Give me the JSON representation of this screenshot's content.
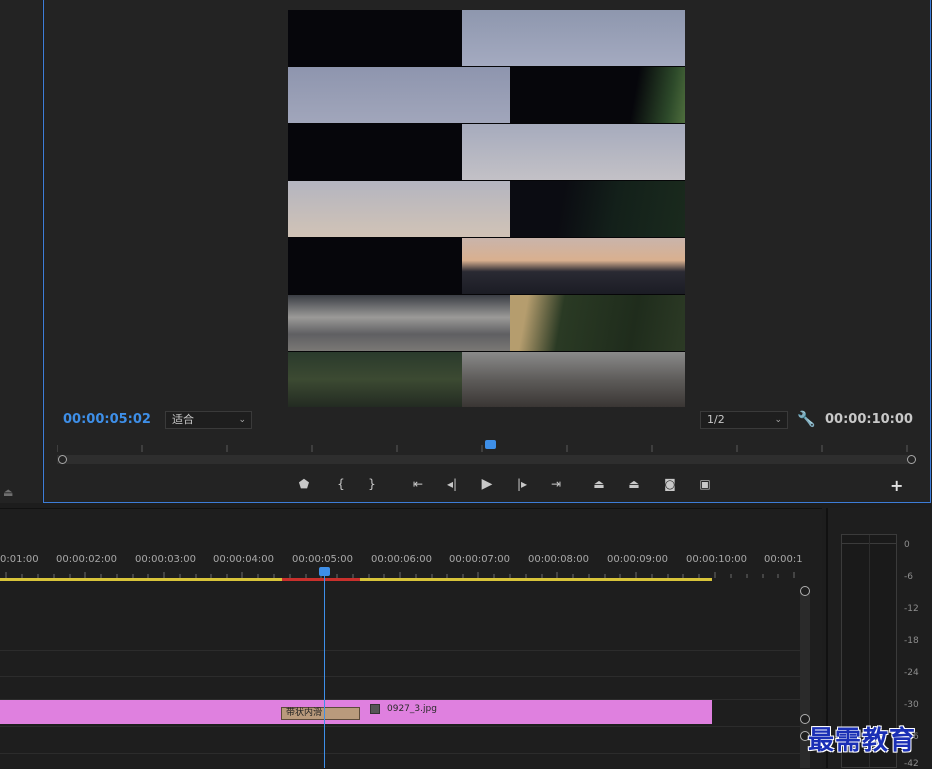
{
  "monitor": {
    "current_timecode": "00:00:05:02",
    "duration_timecode": "00:00:10:00",
    "fit_select": "适合",
    "resolution_select": "1/2",
    "playhead_position_fraction": 0.5
  },
  "transport": {
    "buttons": [
      "marker-icon",
      "mark-in-icon",
      "mark-out-icon",
      "go-to-in-icon",
      "step-back-icon",
      "play-icon",
      "step-forward-icon",
      "go-to-out-icon",
      "lift-icon",
      "extract-icon",
      "export-frame-icon",
      "comparison-view-icon"
    ],
    "add_label": "+"
  },
  "timeline": {
    "ruler_labels": [
      "0:01:00",
      "00:00:02:00",
      "00:00:03:00",
      "00:00:04:00",
      "00:00:05:00",
      "00:00:06:00",
      "00:00:07:00",
      "00:00:08:00",
      "00:00:09:00",
      "00:00:10:00",
      "00:00:1"
    ],
    "clip_name": "0927_3.jpg",
    "transition_name": "带状内滑"
  },
  "meter": {
    "db_labels": [
      "0",
      "-6",
      "-12",
      "-18",
      "-24",
      "-30",
      "-36",
      "-42"
    ]
  },
  "watermark": "最需教育",
  "colors": {
    "accent_blue": "#3e8fe8",
    "clip_pink": "#df80df",
    "workarea_yellow": "#d8c43a",
    "render_red": "#c9302c",
    "transition_tan": "#b99a7c"
  }
}
